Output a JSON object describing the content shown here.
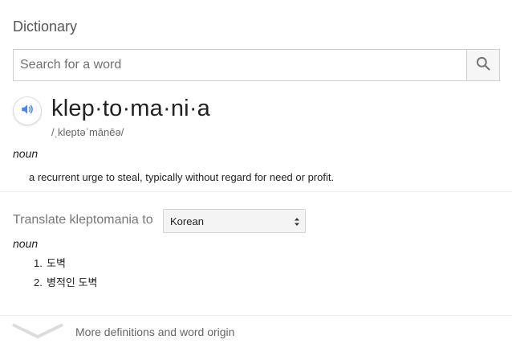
{
  "header": {
    "title": "Dictionary"
  },
  "search": {
    "placeholder": "Search for a word",
    "value": "",
    "icon": "search-icon"
  },
  "entry": {
    "speaker_icon": "volume-icon",
    "word": "klep·to·ma·ni·a",
    "phonetic": "/ˌkleptəˈmānēə/",
    "part_of_speech": "noun",
    "definition": "a recurrent urge to steal, typically without regard for need or profit."
  },
  "translate": {
    "label": "Translate kleptomania to",
    "language": "Korean",
    "part_of_speech": "noun",
    "items": [
      {
        "num": "1.",
        "text": "도벽"
      },
      {
        "num": "2.",
        "text": "병적인 도벽"
      }
    ]
  },
  "footer": {
    "more_label": "More definitions and word origin",
    "chevron_icon": "chevron-down-icon"
  },
  "colors": {
    "accent": "#4285f4",
    "icon_gray": "#757575",
    "border": "#cfcfcf"
  }
}
